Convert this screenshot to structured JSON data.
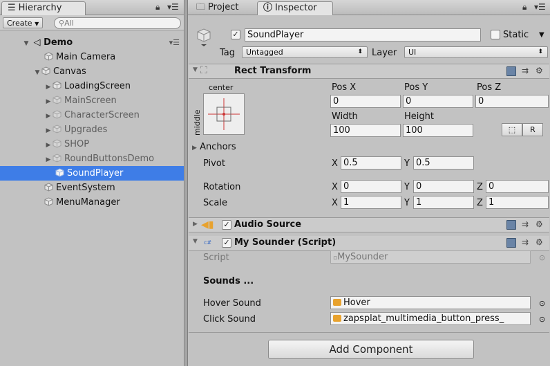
{
  "hierarchy": {
    "tab_label": "Hierarchy",
    "create_label": "Create",
    "search_placeholder": "All",
    "scene_name": "Demo",
    "items": [
      {
        "label": "Main Camera"
      },
      {
        "label": "Canvas"
      },
      {
        "label": "LoadingScreen"
      },
      {
        "label": "MainScreen"
      },
      {
        "label": "CharacterScreen"
      },
      {
        "label": "Upgrades"
      },
      {
        "label": "SHOP"
      },
      {
        "label": "RoundButtonsDemo"
      },
      {
        "label": "SoundPlayer"
      },
      {
        "label": "EventSystem"
      },
      {
        "label": "MenuManager"
      }
    ]
  },
  "tabs": {
    "project_label": "Project",
    "inspector_label": "Inspector"
  },
  "object": {
    "name": "SoundPlayer",
    "static_label": "Static",
    "tag_label": "Tag",
    "tag_value": "Untagged",
    "layer_label": "Layer",
    "layer_value": "UI"
  },
  "rect_transform": {
    "title": "Rect Transform",
    "anchor_h": "center",
    "anchor_v": "middle",
    "pos_x_label": "Pos X",
    "pos_y_label": "Pos Y",
    "pos_z_label": "Pos Z",
    "pos_x": "0",
    "pos_y": "0",
    "pos_z": "0",
    "width_label": "Width",
    "height_label": "Height",
    "width": "100",
    "height": "100",
    "r_button": "R",
    "anchors_label": "Anchors",
    "pivot_label": "Pivot",
    "pivot_x": "0.5",
    "pivot_y": "0.5",
    "rotation_label": "Rotation",
    "rot_x": "0",
    "rot_y": "0",
    "rot_z": "0",
    "scale_label": "Scale",
    "scale_x": "1",
    "scale_y": "1",
    "scale_z": "1",
    "x_label": "X",
    "y_label": "Y",
    "z_label": "Z"
  },
  "audio_source": {
    "title": "Audio Source"
  },
  "my_sounder": {
    "title": "My Sounder (Script)",
    "script_label": "Script",
    "script_value": "MySounder",
    "sounds_header": "Sounds ...",
    "hover_label": "Hover Sound",
    "hover_value": "Hover",
    "click_label": "Click Sound",
    "click_value": "zapsplat_multimedia_button_press_"
  },
  "add_component_label": "Add Component",
  "colors": {
    "selection": "#3e7de7",
    "panel_bg": "#c2c2c2",
    "audio_icon": "#e8a22e"
  }
}
